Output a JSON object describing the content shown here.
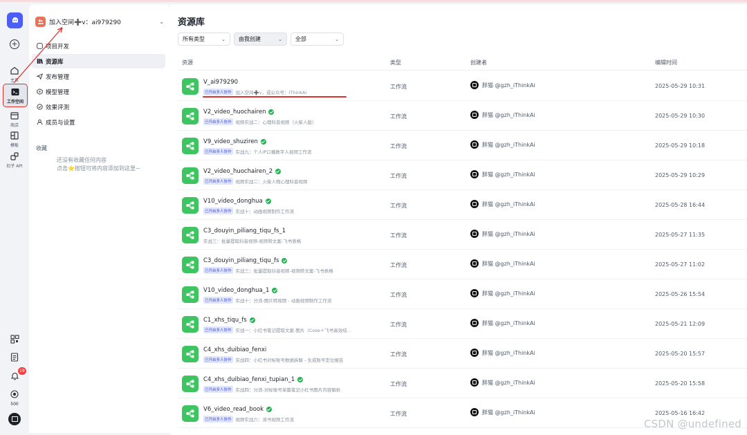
{
  "rail": {
    "items": [
      {
        "label": "主页",
        "icon": "home-icon"
      },
      {
        "label": "工作空间",
        "icon": "workspace-icon"
      },
      {
        "label": "商店",
        "icon": "store-icon"
      },
      {
        "label": "模板",
        "icon": "template-icon"
      },
      {
        "label": "扣子 API",
        "icon": "api-icon"
      }
    ],
    "notification_count": "19",
    "points": "500"
  },
  "sidebar": {
    "space_name": "加入空间➕v：ai979290",
    "nav": [
      {
        "label": "项目开发"
      },
      {
        "label": "资源库"
      },
      {
        "label": "发布管理"
      },
      {
        "label": "模型管理"
      },
      {
        "label": "效果评测"
      },
      {
        "label": "成员与设置"
      }
    ],
    "favorites_title": "收藏",
    "favorites_empty_line1": "还没有收藏任何内容",
    "favorites_empty_line2": "点击⭐按钮可将内容添加到这里~"
  },
  "main": {
    "title": "资源库",
    "filters": [
      {
        "label": "所有类型"
      },
      {
        "label": "由我创建"
      },
      {
        "label": "全部"
      }
    ],
    "columns": {
      "resource": "资源",
      "type": "类型",
      "creator": "创建者",
      "edited": "编辑时间"
    },
    "rows": [
      {
        "name": "V_ai979290",
        "verified": false,
        "tag": "已开启多人协作",
        "desc": "加入空间➕v，或公众号：iThinkAi",
        "type": "工作流",
        "creator": "胖猫 @gzh_iThinkAi",
        "time": "2025-05-29 10:31"
      },
      {
        "name": "V2_video_huochairen",
        "verified": true,
        "tag": "已开启多人协作",
        "desc": "视频实战二：心理科普视频（火柴人版）",
        "type": "工作流",
        "creator": "胖猫 @gzh_iThinkAi",
        "time": "2025-05-29 10:30"
      },
      {
        "name": "V9_video_shuziren",
        "verified": true,
        "tag": "已开启多人协作",
        "desc": "实战九：个人IP口播数字人视频工作流",
        "type": "工作流",
        "creator": "胖猫 @gzh_iThinkAi",
        "time": "2025-05-29 10:18"
      },
      {
        "name": "V2_video_huochairen_2",
        "verified": true,
        "tag": "已开启多人协作",
        "desc": "视频实战二：火柴人物心理科普视频",
        "type": "工作流",
        "creator": "胖猫 @gzh_iThinkAi",
        "time": "2025-05-29 10:29"
      },
      {
        "name": "V10_video_donghua",
        "verified": true,
        "tag": "已开启多人协作",
        "desc": "实战十：动画视频制作工作流",
        "type": "工作流",
        "creator": "胖猫 @gzh_iThinkAi",
        "time": "2025-05-28 16:44"
      },
      {
        "name": "C3_douyin_piliang_tiqu_fs_1",
        "verified": false,
        "tag": "",
        "desc": "实战三：批量提取抖音视频-视频转文案-飞书表格",
        "type": "工作流",
        "creator": "胖猫 @gzh_iThinkAi",
        "time": "2025-05-27 11:35"
      },
      {
        "name": "C3_douyin_piliang_tiqu_fs",
        "verified": true,
        "tag": "已开启多人协作",
        "desc": "实战三：批量提取抖音视频-视频转文案-飞书表格",
        "type": "工作流",
        "creator": "胖猫 @gzh_iThinkAi",
        "time": "2025-05-27 11:02"
      },
      {
        "name": "V10_video_donghua_1",
        "verified": true,
        "tag": "已开启多人协作",
        "desc": "实战十：分流-图片转视频 - 动画视频制作工作流",
        "type": "工作流",
        "creator": "胖猫 @gzh_iThinkAi",
        "time": "2025-05-26 15:54"
      },
      {
        "name": "C1_xhs_tiqu_fs",
        "verified": true,
        "tag": "已开启多人协作",
        "desc": "实战一：小红书笔记提取文案-图片（Coze＋飞书高效结…",
        "type": "工作流",
        "creator": "胖猫 @gzh_iThinkAi",
        "time": "2025-05-21 12:09"
      },
      {
        "name": "C4_xhs_duibiao_fenxi",
        "verified": false,
        "tag": "已开启多人协作",
        "desc": "实战四：小红书对标账号数据拆解 - 生成账号定位报告",
        "type": "工作流",
        "creator": "胖猫 @gzh_iThinkAi",
        "time": "2025-05-20 15:57"
      },
      {
        "name": "C4_xhs_duibiao_fenxi_tupian_1",
        "verified": true,
        "tag": "已开启多人协作",
        "desc": "实战四：分流-对标账号单篇笔记小红书图片内容解析",
        "type": "工作流",
        "creator": "胖猫 @gzh_iThinkAi",
        "time": "2025-05-20 15:58"
      },
      {
        "name": "V6_video_read_book",
        "verified": true,
        "tag": "已开启多人协作",
        "desc": "视频实战六：读书视频工作流",
        "type": "工作流",
        "creator": "胖猫 @gzh_iThinkAi",
        "time": "2025-05-16 16:42"
      }
    ]
  },
  "watermark": "CSDN @undefined",
  "colors": {
    "accent": "#4c5ef5",
    "workflow_green": "#3ec562",
    "annotation_red": "#e0302b",
    "tag_bg": "#e2e6fb"
  }
}
